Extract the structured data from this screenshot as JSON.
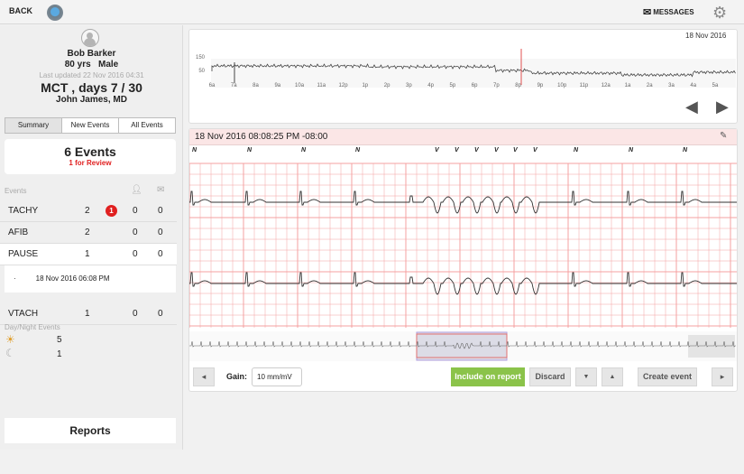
{
  "header": {
    "back_label": "BACK",
    "messages_label": "MESSAGES",
    "icons": [
      "hospital-logo-icon",
      "envelope-icon",
      "gear-icon"
    ]
  },
  "patient": {
    "name": "Bob Barker",
    "age": "80 yrs",
    "sex": "Male",
    "last_updated": "Last updated 22 Nov 2016 04:31",
    "study": "MCT , days 7 / 30",
    "physician": "John James, MD"
  },
  "tabs": [
    {
      "label": "Summary",
      "active": true
    },
    {
      "label": "New Events"
    },
    {
      "label": "All Events"
    }
  ],
  "summary": {
    "events": "6 Events",
    "review": "1 for Review"
  },
  "events_table": {
    "header": "Events",
    "rows": [
      {
        "type": "TACHY",
        "count": "2",
        "badge": "1",
        "reviewed": "0",
        "sent": "0"
      },
      {
        "type": "AFIB",
        "count": "2",
        "reviewed": "0",
        "sent": "0"
      },
      {
        "type": "PAUSE",
        "count": "1",
        "reviewed": "0",
        "sent": "0"
      },
      {
        "type": "VTACH",
        "count": "1",
        "reviewed": "0",
        "sent": "0"
      }
    ],
    "expanded_item": "18 Nov 2016 06:08 PM"
  },
  "day_night": {
    "title": "Day/Night Events",
    "day": "5",
    "night": "1"
  },
  "reports_label": "Reports",
  "trend": {
    "date": "18 Nov 2016",
    "y_labels": [
      "150",
      "50"
    ],
    "x_labels": [
      "6a",
      "7a",
      "8a",
      "9a",
      "10a",
      "11a",
      "12p",
      "1p",
      "2p",
      "3p",
      "4p",
      "5p",
      "6p",
      "7p",
      "8p",
      "9p",
      "10p",
      "11p",
      "12a",
      "1a",
      "2a",
      "3a",
      "4a",
      "5a"
    ],
    "marker_color": "#e05050"
  },
  "strip": {
    "title": "18 Nov 2016 08:08:25 PM -08:00",
    "beats": [
      "N",
      "N",
      "N",
      "N",
      "V",
      "V",
      "V",
      "V",
      "V",
      "V",
      "N",
      "N",
      "N"
    ],
    "grid_color": "#f4a0a0",
    "header_bg": "#fbe6e6"
  },
  "controls": {
    "gain_label": "Gain:",
    "gain_value": "10 mm/mV",
    "include_label": "Include on report",
    "discard_label": "Discard",
    "create_label": "Create event",
    "include_color": "#8bc34a"
  }
}
